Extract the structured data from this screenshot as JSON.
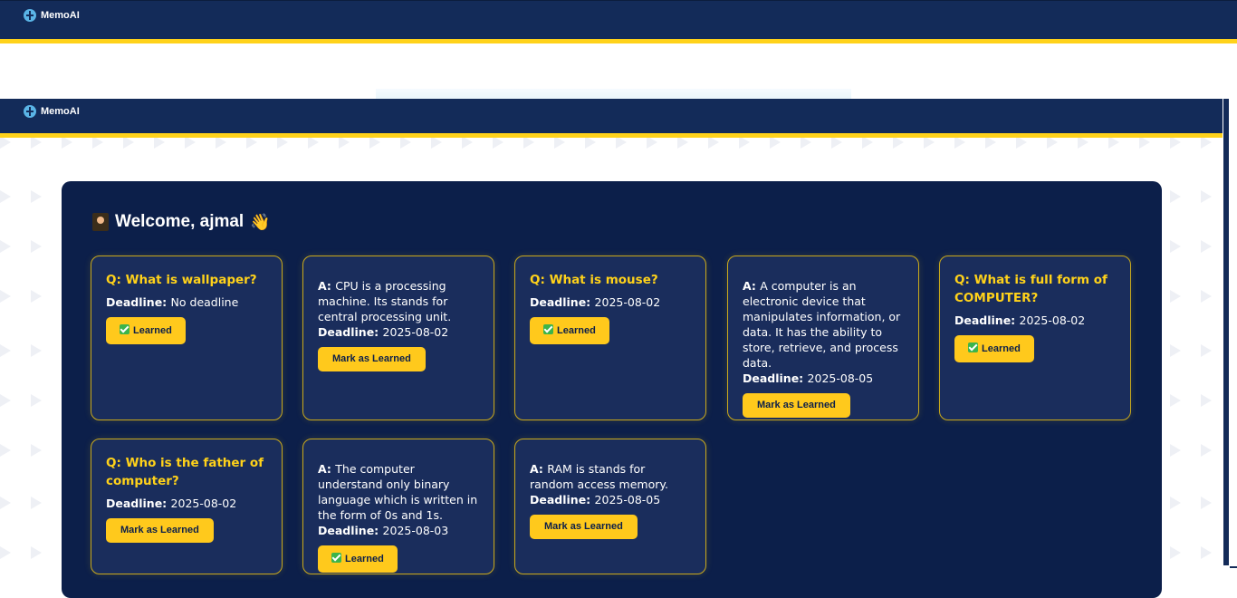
{
  "app": {
    "name": "MemoAI"
  },
  "welcome": {
    "text": "Welcome, ajmal"
  },
  "labels": {
    "question_prefix": "Q:",
    "answer_prefix": "A:",
    "deadline": "Deadline:",
    "mark_button": "Mark as Learned",
    "learned_button": "Learned"
  },
  "cards": [
    {
      "kind": "question",
      "text": "What is wallpaper?",
      "deadline": "No deadline",
      "status": "learned"
    },
    {
      "kind": "answer",
      "text": "CPU is a processing machine. Its stands for central processing unit.",
      "deadline": "2025-08-02",
      "status": "pending"
    },
    {
      "kind": "question",
      "text": "What is mouse?",
      "deadline": "2025-08-02",
      "status": "learned"
    },
    {
      "kind": "answer",
      "text": "A computer is an electronic device that manipulates information, or data. It has the ability to store, retrieve, and process data.",
      "deadline": "2025-08-05",
      "status": "pending"
    },
    {
      "kind": "question",
      "text": "What is full form of COMPUTER?",
      "deadline": "2025-08-02",
      "status": "learned"
    },
    {
      "kind": "question",
      "text": "Who is the father of computer?",
      "deadline": "2025-08-02",
      "status": "pending"
    },
    {
      "kind": "answer",
      "text": "The computer understand only binary language which is written in the form of 0s and 1s.",
      "deadline": "2025-08-03",
      "status": "learned"
    },
    {
      "kind": "answer",
      "text": "RAM is stands for random access memory.",
      "deadline": "2025-08-05",
      "status": "pending"
    }
  ],
  "colors": {
    "navbar": "#132b59",
    "accent": "#ffd21a",
    "panel": "#0c1f4a",
    "card": "#1a2d5c",
    "button": "#ffc91c"
  }
}
